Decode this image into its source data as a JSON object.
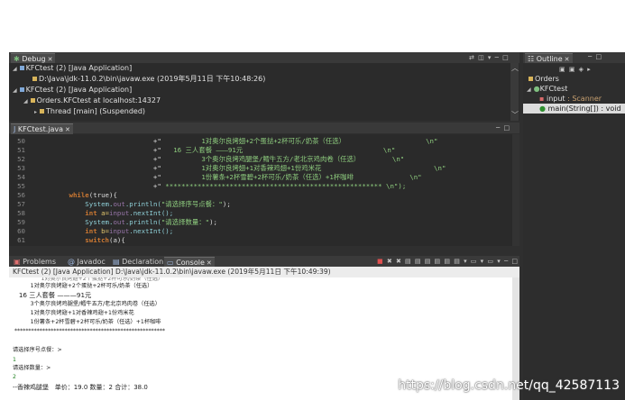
{
  "debug": {
    "tab": "Debug",
    "items": [
      "KFCtest (2) [Java Application]",
      "D:\\Java\\jdk-11.0.2\\bin\\javaw.exe (2019年5月11日 下午10:48:26)",
      "KFCtest (2) [Java Application]",
      "Orders.KFCtest at localhost:14327",
      "Thread [main] (Suspended)"
    ]
  },
  "outline": {
    "tab": "Outline",
    "items": [
      "Orders",
      "KFCtest",
      "input",
      ": Scanner",
      "main(String[]) : void"
    ]
  },
  "editor": {
    "tab": "KFCtest.java",
    "lines": [
      {
        "n": "50",
        "a": "                               +\"",
        "s": "          1对奥尔良烤翅+2个蛋挞+2杯可乐/奶茶（任选）",
        "b": "                    \\n\""
      },
      {
        "n": "51",
        "a": "                               +\"",
        "s": "   16 三人套餐 ———91元",
        "b": "                                   \\n\""
      },
      {
        "n": "52",
        "a": "                               +\"",
        "s": "          3个奥尔良烤鸡腿堡/鳕牛五方/老北京鸡肉卷（任选）",
        "b": "        \\n\""
      },
      {
        "n": "53",
        "a": "                               +\"",
        "s": "          1对奥尔良烤翅+1对香辣鸡翅+1份鸡米花",
        "b": "                            \\n\""
      },
      {
        "n": "54",
        "a": "                               +\"",
        "s": "          1份薯条+2杯雪碧+2杯可乐/奶茶（任选）+1杯咖啡",
        "b": "              \\n\""
      },
      {
        "n": "55",
        "a": "                               +\"",
        "s": " ******************************************************",
        "b": " \\n\");"
      },
      {
        "n": "56",
        "a": "",
        "s": "",
        "b": ""
      },
      {
        "n": "57",
        "a": "",
        "s": "",
        "b": ""
      },
      {
        "n": "58",
        "a": "",
        "s": "",
        "b": ""
      },
      {
        "n": "59",
        "a": "",
        "s": "",
        "b": ""
      },
      {
        "n": "60",
        "a": "",
        "s": "",
        "b": ""
      },
      {
        "n": "61",
        "a": "",
        "s": "",
        "b": ""
      }
    ],
    "l56": {
      "kw": "while",
      "rest": "(true){"
    },
    "l57": {
      "a": "System.",
      "f": "out",
      "b": ".println(",
      "s": "\"请选择序号点餐：\"",
      "c": ");"
    },
    "l58": {
      "kw": "int",
      "a": " a=",
      "f": "input",
      "b": ".nextInt();"
    },
    "l59": {
      "a": "System.",
      "f": "out",
      "b": ".println(",
      "s": "\"请选择数量：\"",
      "c": ");"
    },
    "l60": {
      "kw": "int",
      "a": " b=",
      "f": "input",
      "b": ".nextInt();"
    },
    "l61": {
      "kw": "switch",
      "rest": "(a){"
    }
  },
  "bottom": {
    "tabs": [
      "Problems",
      "Javadoc",
      "Declaration",
      "Console"
    ],
    "console_title": "KFCtest (2) [Java Application] D:\\Java\\jdk-11.0.2\\bin\\javaw.exe (2019年5月11日 下午10:49:39)",
    "lines": [
      "          1对奥尔良烤翅+2个蛋挞+2杯可乐/奶茶（任选）",
      "   16 三人套餐 ———91元",
      "          3个奥尔良烤鸡腿堡/鳕牛五方/老北京鸡肉卷（任选）",
      "          1对奥尔良烤翅+1对香辣鸡翅+1份鸡米花",
      "          1份薯条+2杯雪碧+2杯可乐/奶茶（任选）+1杯咖啡",
      " ******************************************************",
      "",
      "请选择序号点餐：>",
      "1",
      "请选择数量：>",
      "2",
      "--香辣鸡腿堡   单价：19.0 数量：2 合计：38.0"
    ]
  },
  "watermark": "https://blog.csdn.net/qq_42587113"
}
